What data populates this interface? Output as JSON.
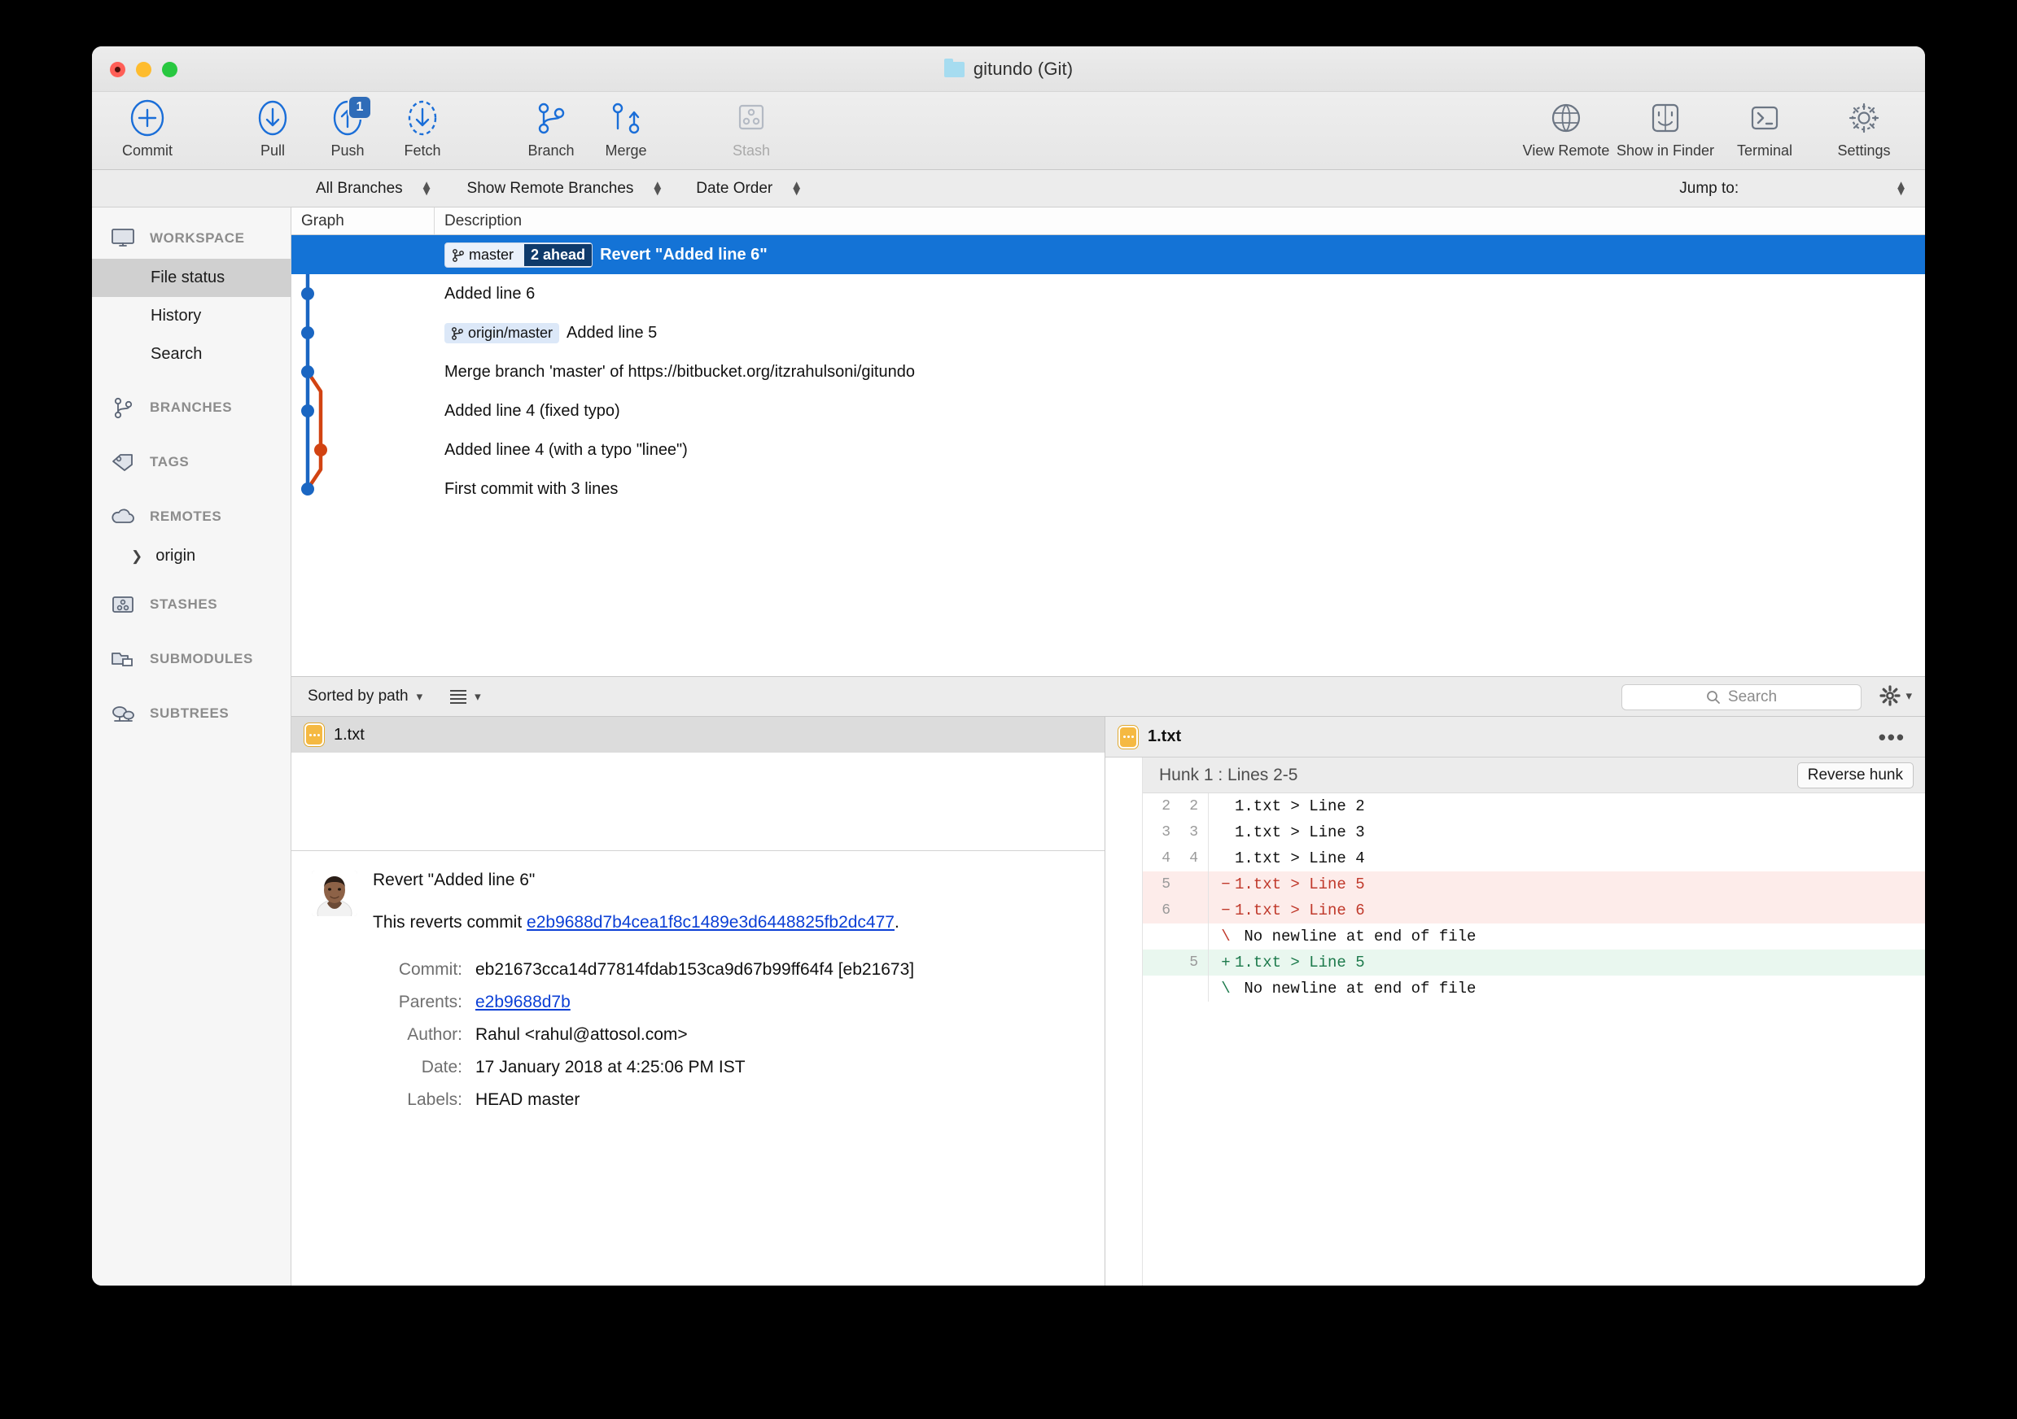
{
  "window": {
    "title": "gitundo (Git)",
    "folder_icon": "folder-icon",
    "traffic_lights": [
      "close",
      "minimize",
      "zoom"
    ]
  },
  "toolbar": {
    "left_items": [
      {
        "label": "Commit",
        "icon": "commit-plus-icon",
        "badge": null,
        "disabled": false
      },
      {
        "label": "Pull",
        "icon": "pull-down-arrow-icon",
        "badge": null,
        "disabled": false
      },
      {
        "label": "Push",
        "icon": "push-up-arrow-icon",
        "badge": "1",
        "disabled": false
      },
      {
        "label": "Fetch",
        "icon": "fetch-dashed-arrow-icon",
        "badge": null,
        "disabled": false
      },
      {
        "label": "Branch",
        "icon": "branch-icon",
        "badge": null,
        "disabled": false
      },
      {
        "label": "Merge",
        "icon": "merge-icon",
        "badge": null,
        "disabled": false
      },
      {
        "label": "Stash",
        "icon": "stash-icon",
        "badge": null,
        "disabled": true
      }
    ],
    "right_items": [
      {
        "label": "View Remote",
        "icon": "globe-icon"
      },
      {
        "label": "Show in Finder",
        "icon": "finder-icon"
      },
      {
        "label": "Terminal",
        "icon": "terminal-icon"
      },
      {
        "label": "Settings",
        "icon": "gear-icon"
      }
    ]
  },
  "filterbar": {
    "branch_filter": "All Branches",
    "remote_filter": "Show Remote Branches",
    "order_filter": "Date Order",
    "jump_to_label": "Jump to:"
  },
  "sidebar": {
    "sections": [
      {
        "kind": "section",
        "label": "WORKSPACE",
        "icon": "monitor-icon"
      },
      {
        "kind": "item",
        "label": "File status",
        "selected": true
      },
      {
        "kind": "item",
        "label": "History",
        "selected": false
      },
      {
        "kind": "item",
        "label": "Search",
        "selected": false
      },
      {
        "kind": "section",
        "label": "BRANCHES",
        "icon": "branch-icon"
      },
      {
        "kind": "section",
        "label": "TAGS",
        "icon": "tag-icon"
      },
      {
        "kind": "section",
        "label": "REMOTES",
        "icon": "cloud-icon"
      },
      {
        "kind": "sub",
        "label": "origin",
        "icon": "chevron-right-icon"
      },
      {
        "kind": "section",
        "label": "STASHES",
        "icon": "stash-icon"
      },
      {
        "kind": "section",
        "label": "SUBMODULES",
        "icon": "submodule-icon"
      },
      {
        "kind": "section",
        "label": "SUBTREES",
        "icon": "subtree-icon"
      }
    ]
  },
  "commit_table": {
    "columns": [
      "Graph",
      "Description"
    ],
    "rows": [
      {
        "refs": [
          {
            "name": "master",
            "count": "2 ahead"
          }
        ],
        "description": "Revert \"Added line 6\"",
        "selected": true
      },
      {
        "refs": [],
        "description": "Added line 6",
        "selected": false
      },
      {
        "refs": [
          {
            "name": "origin/master",
            "count": null
          }
        ],
        "description": "Added line 5",
        "selected": false
      },
      {
        "refs": [],
        "description": "Merge branch 'master' of https://bitbucket.org/itzrahulsoni/gitundo",
        "selected": false
      },
      {
        "refs": [],
        "description": "Added line 4 (fixed typo)",
        "selected": false
      },
      {
        "refs": [],
        "description": "Added linee 4 (with a typo \"linee\")",
        "selected": false
      },
      {
        "refs": [],
        "description": "First commit with 3 lines",
        "selected": false
      }
    ],
    "graph": {
      "blue": "#1a66c2",
      "orange": "#d24312"
    }
  },
  "lowerbar": {
    "sort_label": "Sorted by path",
    "search_placeholder": "Search",
    "list_icon": "list-view-icon",
    "gear_icon": "gear-icon"
  },
  "file_list": {
    "files": [
      {
        "name": "1.txt",
        "status_icon": "modified-file-icon"
      }
    ]
  },
  "commit_detail": {
    "avatar": "user-avatar",
    "title": "Revert \"Added line 6\"",
    "reverts_prefix": "This reverts commit ",
    "reverts_sha": "e2b9688d7b4cea1f8c1489e3d6448825fb2dc477",
    "reverts_suffix": ".",
    "fields": [
      {
        "key": "Commit:",
        "value": "eb21673cca14d77814fdab153ca9d67b99ff64f4 [eb21673]",
        "link": false
      },
      {
        "key": "Parents:",
        "value": "e2b9688d7b",
        "link": true
      },
      {
        "key": "Author:",
        "value": "Rahul <rahul@attosol.com>",
        "link": false
      },
      {
        "key": "Date:",
        "value": "17 January 2018 at 4:25:06 PM IST",
        "link": false
      },
      {
        "key": "Labels:",
        "value": "HEAD master",
        "link": false
      }
    ]
  },
  "diff_panel": {
    "file_name": "1.txt",
    "file_status_icon": "modified-file-icon",
    "more_icon": "ellipsis-icon",
    "hunk_title": "Hunk 1 : Lines 2-5",
    "reverse_button": "Reverse hunk",
    "lines": [
      {
        "old": "2",
        "new": "2",
        "sign": "",
        "text": "1.txt > Line 2",
        "type": "ctx"
      },
      {
        "old": "3",
        "new": "3",
        "sign": "",
        "text": "1.txt > Line 3",
        "type": "ctx"
      },
      {
        "old": "4",
        "new": "4",
        "sign": "",
        "text": "1.txt > Line 4",
        "type": "ctx"
      },
      {
        "old": "5",
        "new": "",
        "sign": "−",
        "text": "1.txt > Line 5",
        "type": "del"
      },
      {
        "old": "6",
        "new": "",
        "sign": "−",
        "text": "1.txt > Line 6",
        "type": "del"
      },
      {
        "old": "",
        "new": "",
        "sign": "\\",
        "text": " No newline at end of file",
        "type": "nonl"
      },
      {
        "old": "",
        "new": "5",
        "sign": "+",
        "text": "1.txt > Line 5",
        "type": "add"
      },
      {
        "old": "",
        "new": "",
        "sign": "\\",
        "text": " No newline at end of file",
        "type": "nonl-green"
      }
    ]
  },
  "colors": {
    "selection_blue": "#1473d6",
    "graph_blue": "#1a66c2",
    "graph_orange": "#d24312",
    "link_blue": "#0b3fd6",
    "diff_add_bg": "#e9f7ef",
    "diff_del_bg": "#fdecea",
    "badge_blue": "#2f6cb8"
  }
}
